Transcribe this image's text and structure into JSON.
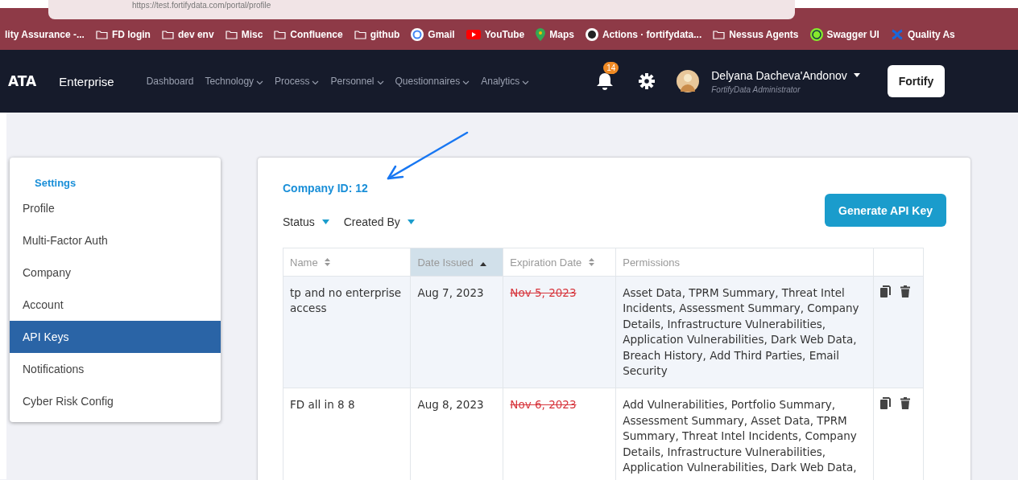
{
  "browser": {
    "url": "https://test.fortifydata.com/portal/profile"
  },
  "bookmarks": [
    {
      "label": "lity Assurance -...",
      "kind": "plain"
    },
    {
      "label": "FD login",
      "kind": "folder"
    },
    {
      "label": "dev env",
      "kind": "folder"
    },
    {
      "label": "Misc",
      "kind": "folder"
    },
    {
      "label": "Confluence",
      "kind": "folder"
    },
    {
      "label": "github",
      "kind": "folder"
    },
    {
      "label": "Gmail",
      "kind": "google"
    },
    {
      "label": "YouTube",
      "kind": "youtube"
    },
    {
      "label": "Maps",
      "kind": "maps"
    },
    {
      "label": "Actions · fortifydata...",
      "kind": "github"
    },
    {
      "label": "Nessus Agents",
      "kind": "folder"
    },
    {
      "label": "Swagger UI",
      "kind": "swagger"
    },
    {
      "label": "Quality As",
      "kind": "confluence"
    }
  ],
  "navbar": {
    "logo": "ATA",
    "product": "Enterprise",
    "menu": [
      {
        "label": "Dashboard",
        "dropdown": false
      },
      {
        "label": "Technology",
        "dropdown": true
      },
      {
        "label": "Process",
        "dropdown": true
      },
      {
        "label": "Personnel",
        "dropdown": true
      },
      {
        "label": "Questionnaires",
        "dropdown": true
      },
      {
        "label": "Analytics",
        "dropdown": true
      }
    ],
    "notifications": "14",
    "user_name": "Delyana Dacheva'Andonov",
    "user_role": "FortifyData Administrator",
    "right_button": "Fortify"
  },
  "sidebar": {
    "title": "Settings",
    "items": [
      {
        "label": "Profile",
        "selected": false
      },
      {
        "label": "Multi-Factor Auth",
        "selected": false
      },
      {
        "label": "Company",
        "selected": false
      },
      {
        "label": "Account",
        "selected": false
      },
      {
        "label": "API Keys",
        "selected": true
      },
      {
        "label": "Notifications",
        "selected": false
      },
      {
        "label": "Cyber Risk Config",
        "selected": false
      }
    ]
  },
  "main": {
    "company_id": "Company ID: 12",
    "filters": [
      "Status",
      "Created By"
    ],
    "generate_button": "Generate API Key",
    "table": {
      "columns": [
        {
          "label": "Name",
          "sortable": true,
          "sorted": false
        },
        {
          "label": "Date Issued",
          "sortable": true,
          "sorted": true
        },
        {
          "label": "Expiration Date",
          "sortable": true,
          "sorted": false
        },
        {
          "label": "Permissions",
          "sortable": false,
          "sorted": false
        }
      ],
      "rows": [
        {
          "name": "tp and no enterprise access",
          "issued": "Aug 7, 2023",
          "expires": "Nov 5, 2023",
          "expired": true,
          "permissions": "Asset Data, TPRM Summary, Threat Intel Incidents, Assessment Summary, Company Details, Infrastructure Vulnerabilities, Application Vulnerabilities, Dark Web Data, Breach History, Add Third Parties, Email Security",
          "shaded": true
        },
        {
          "name": "FD all in 8 8",
          "issued": "Aug 8, 2023",
          "expires": "Nov 6, 2023",
          "expired": true,
          "permissions": "Add Vulnerabilities, Portfolio Summary, Assessment Summary, Asset Data, TPRM Summary, Threat Intel Incidents, Company Details, Infrastructure Vulnerabilities, Application Vulnerabilities, Dark Web Data,",
          "shaded": false
        }
      ]
    }
  }
}
